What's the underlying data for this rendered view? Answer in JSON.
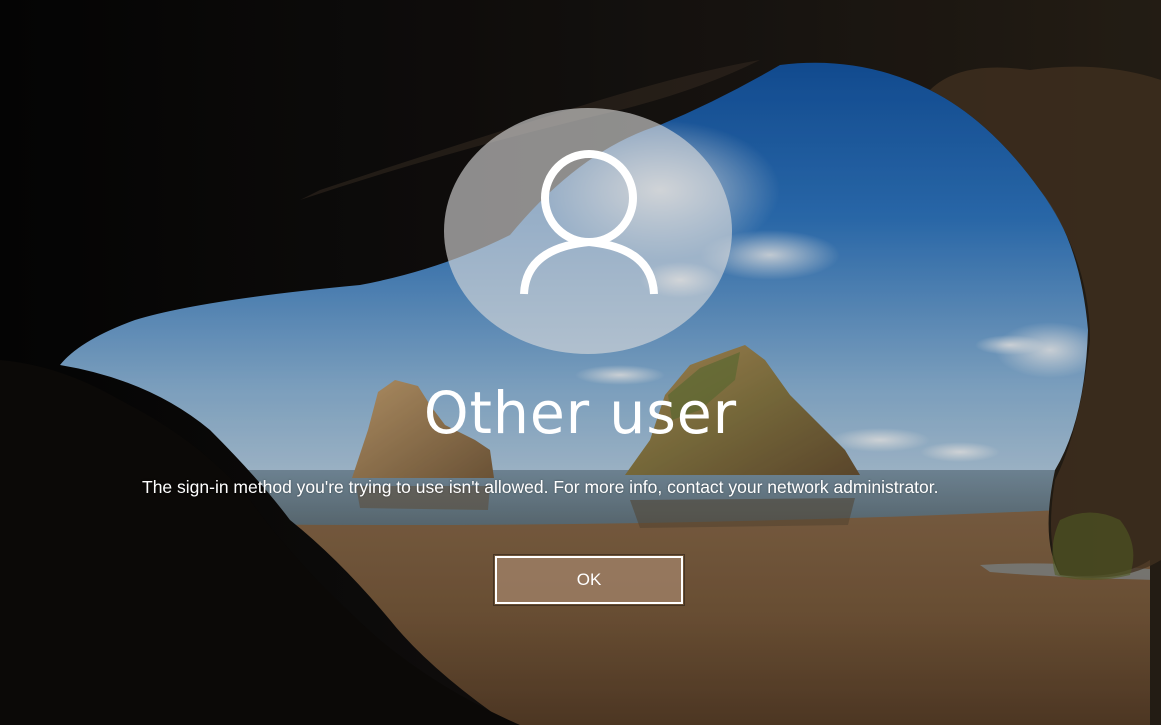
{
  "login": {
    "username": "Other user",
    "message": "The sign-in method you're trying to use isn't allowed. For more info, contact your network administrator.",
    "ok_label": "OK"
  },
  "icons": {
    "avatar": "user-silhouette-icon"
  },
  "colors": {
    "text": "#ffffff",
    "button_fill": "#a08268",
    "button_border": "#ffffff",
    "avatar_fill": "#dcdcdc"
  }
}
